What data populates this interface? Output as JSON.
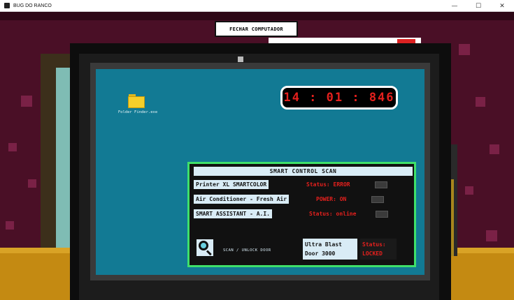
{
  "window": {
    "title": "BUG DO RANCO",
    "minimize": "—",
    "maximize": "☐",
    "close": "✕"
  },
  "game": {
    "close_computer_label": "FECHAR COMPUTADOR",
    "desktop": {
      "folder_label": "Folder Finder.exe",
      "clock": "14 : 01 : 846"
    },
    "control_panel": {
      "title": "SMART CONTROL SCAN",
      "devices": [
        {
          "name": "Printer XL SMARTCOLOR",
          "status": "Status: ERROR"
        },
        {
          "name": "Air Conditioner - Fresh Air",
          "status": "POWER: ON"
        },
        {
          "name": "SMART ASSISTANT - A.I.",
          "status": "Status: online"
        }
      ],
      "scan_label": "SCAN  /  UNLOCK DOOR",
      "door": {
        "name_line1": "Ultra Blast",
        "name_line2": "Door 3000",
        "status_line1": "Status:",
        "status_line2": "LOCKED"
      }
    },
    "colors": {
      "screen": "#127a94",
      "panel_border": "#3fe06a",
      "status_red": "#e4201d",
      "wall": "#4a0f26",
      "desk": "#c48a12"
    },
    "icons": [
      "folder-icon",
      "magnifier-icon"
    ]
  }
}
